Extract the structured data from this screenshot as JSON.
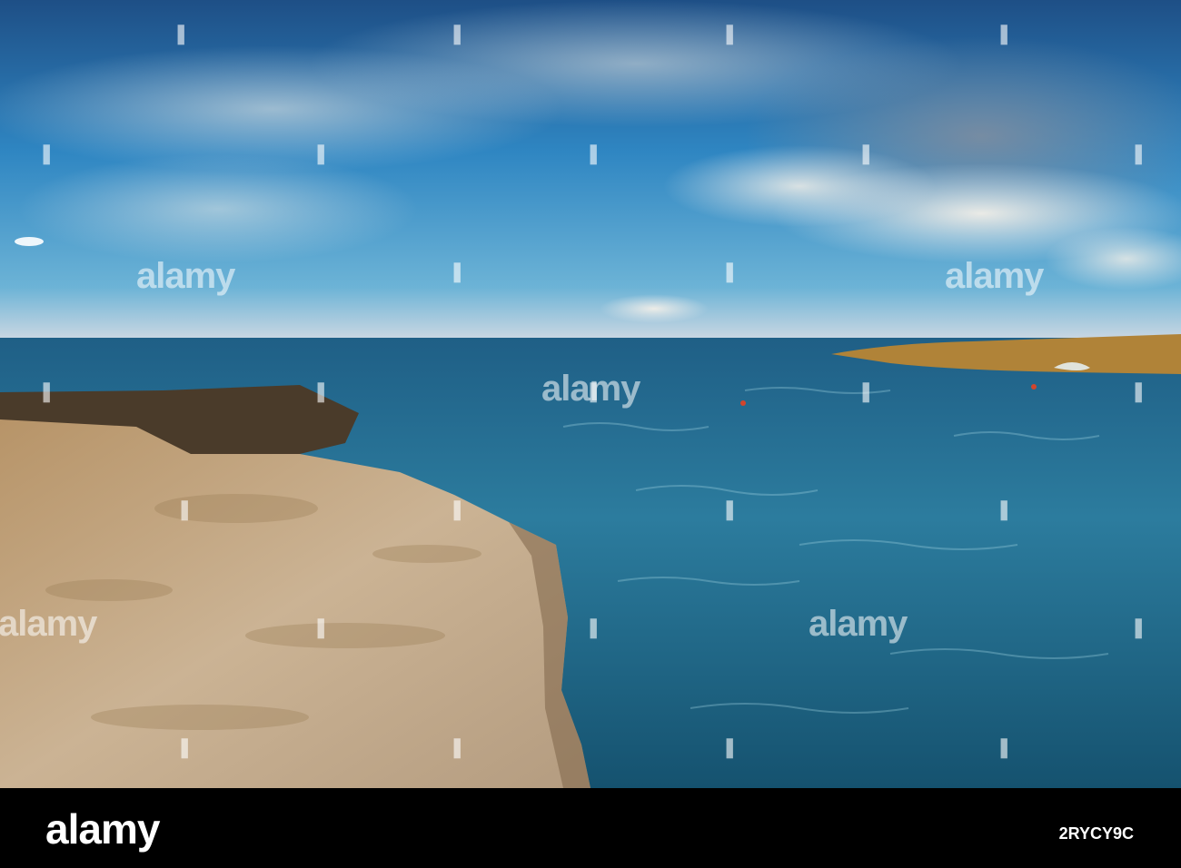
{
  "image": {
    "watermark_text": "alamy",
    "footer": {
      "logo": "alamy",
      "image_id": "2RYCY9C"
    }
  }
}
